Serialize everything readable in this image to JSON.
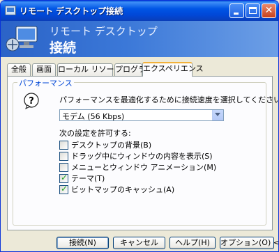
{
  "window": {
    "title": "リモート デスクトップ接続"
  },
  "banner": {
    "line1": "リモート デスクトップ",
    "line2": "接続"
  },
  "tabs": [
    "全般",
    "画面",
    "ローカル リソース",
    "プログラム",
    "エクスペリエンス"
  ],
  "active_tab": "エクスペリエンス",
  "performance": {
    "group_label": "パフォーマンス",
    "instruction": "パフォーマンスを最適化するために接続速度を選択してください(P)",
    "speed_selected": "モデム (56 Kbps)",
    "allow_label": "次の設定を許可する:",
    "options": [
      {
        "label": "デスクトップの背景(B)",
        "checked": false
      },
      {
        "label": "ドラッグ中にウィンドウの内容を表示(S)",
        "checked": false
      },
      {
        "label": "メニューとウィンドウ アニメーション(M)",
        "checked": false
      },
      {
        "label": "テーマ(T)",
        "checked": true
      },
      {
        "label": "ビットマップのキャッシュ(A)",
        "checked": true
      }
    ]
  },
  "buttons": {
    "connect": "接続(N)",
    "cancel": "キャンセル",
    "help": "ヘルプ(H)",
    "options": "オプション(O) <<"
  },
  "colors": {
    "titlebar": "#0054e3",
    "group_label": "#0046d5",
    "active_tab_accent": "#f2b13a",
    "check": "#21a121"
  }
}
